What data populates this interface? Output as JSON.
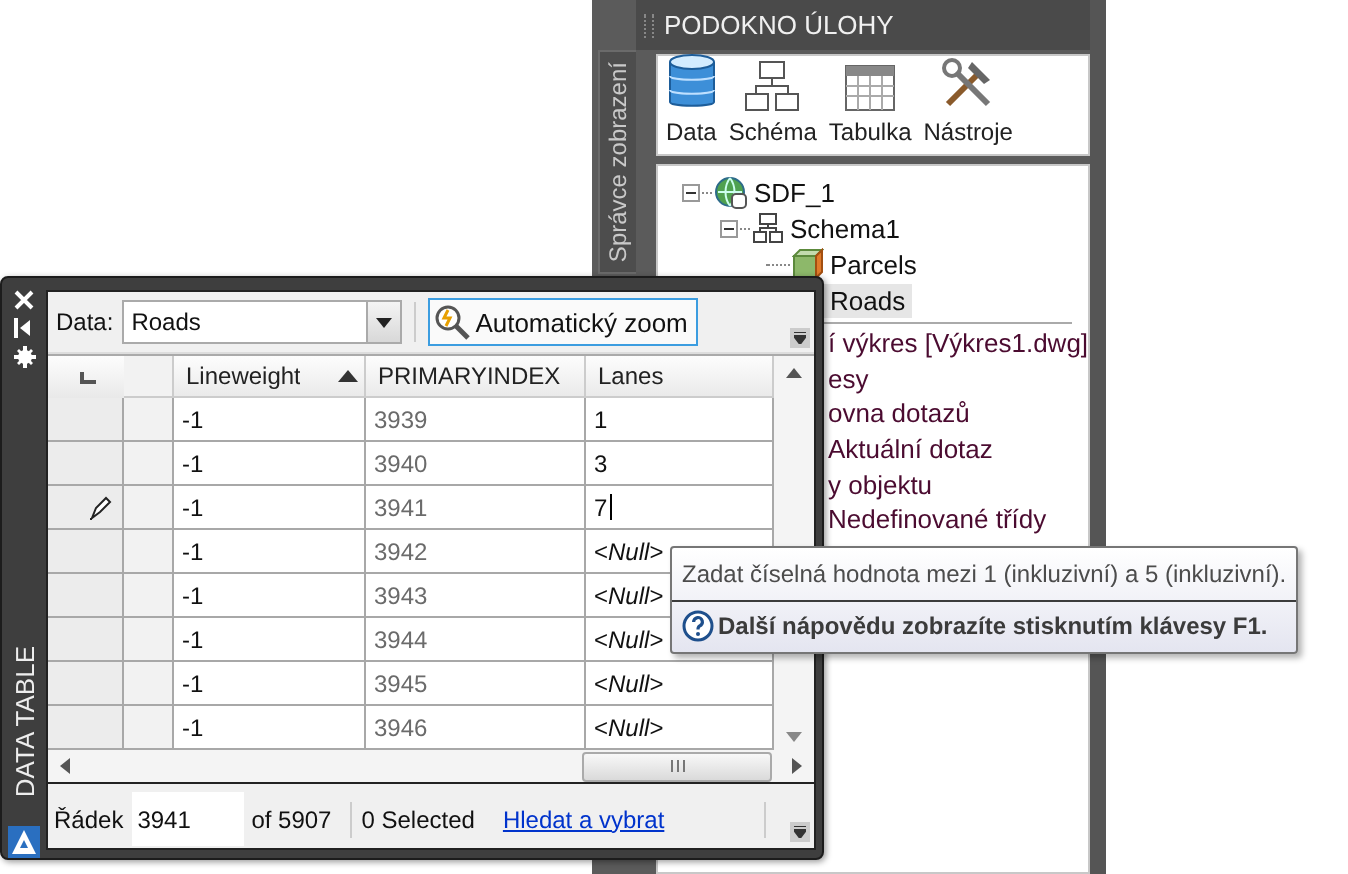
{
  "task_pane": {
    "title": "PODOKNO ÚLOHY",
    "side_tab": "Správce zobrazení",
    "toolbar": [
      {
        "label": "Data",
        "kind": "data"
      },
      {
        "label": "Schéma",
        "kind": "schema"
      },
      {
        "label": "Tabulka",
        "kind": "table"
      },
      {
        "label": "Nástroje",
        "kind": "tools"
      }
    ],
    "tree": [
      {
        "label": "SDF_1",
        "kind": "source",
        "expanded": true,
        "selected": false,
        "children": [
          {
            "label": "Schema1",
            "kind": "schema",
            "expanded": true,
            "selected": false,
            "children": [
              {
                "label": "Parcels",
                "kind": "polygon",
                "selected": false
              },
              {
                "label": "Roads",
                "selected": true
              }
            ]
          }
        ]
      }
    ],
    "map_items": [
      {
        "label": "í výkres [Výkres1.dwg]"
      },
      {
        "label": "esy"
      },
      {
        "label": "ovna dotazů"
      },
      {
        "label": "Aktuální dotaz"
      },
      {
        "label": "y objektu"
      },
      {
        "label": "Nedefinované třídy"
      }
    ]
  },
  "data_table": {
    "title": "DATA TABLE",
    "data_label": "Data:",
    "source": "Roads",
    "zoom_button": "Automatický zoom",
    "columns": [
      {
        "label": "Lineweight",
        "sorted": true
      },
      {
        "label": "PRIMARYINDEX",
        "sorted": false
      },
      {
        "label": "Lanes",
        "sorted": false
      }
    ],
    "rows": [
      {
        "cells": [
          "-1",
          "3939",
          "1"
        ],
        "editing": false
      },
      {
        "cells": [
          "-1",
          "3940",
          "3"
        ],
        "editing": false
      },
      {
        "cells": [
          "-1",
          "3941",
          "7"
        ],
        "editing": true
      },
      {
        "cells": [
          "-1",
          "3942",
          "<*Null*>"
        ],
        "editing": false
      },
      {
        "cells": [
          "-1",
          "3943",
          "<*Null*>"
        ],
        "editing": false
      },
      {
        "cells": [
          "-1",
          "3944",
          "<*Null*>"
        ],
        "editing": false
      },
      {
        "cells": [
          "-1",
          "3945",
          "<*Null*>"
        ],
        "editing": false
      },
      {
        "cells": [
          "-1",
          "3946",
          "<*Null*>"
        ],
        "editing": false
      }
    ],
    "status": {
      "row_label": "Řádek",
      "row_value": "3941",
      "total": "of 5907",
      "selected": "0 Selected",
      "link": "Hledat a vybrat"
    }
  },
  "tooltip": {
    "text": "Zadat číselná hodnota mezi 1 (inkluzivní) a 5 (inkluzivní).",
    "help": "Další nápovědu zobrazíte stisknutím klávesy F1."
  }
}
